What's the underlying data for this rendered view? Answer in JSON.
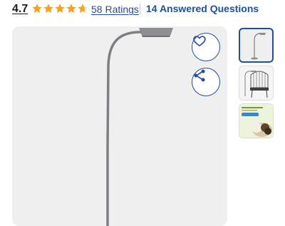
{
  "rating": {
    "value": "4.7",
    "stars_out_of_5": 4.7,
    "ratings_count_label": "58 Ratings",
    "questions_label": "14 Answered Questions"
  },
  "colors": {
    "star": "#f5a21e",
    "link": "#1f4ea3",
    "image_bg": "#efefef"
  },
  "product_image": {
    "icons": {
      "favorite": "heart-icon",
      "share": "share-icon"
    }
  },
  "thumbnails": [
    {
      "label": "floor-lamp-thumbnail",
      "selected": true
    },
    {
      "label": "birdcage-thumbnail",
      "selected": false
    },
    {
      "label": "review-promo-thumbnail",
      "selected": false
    }
  ]
}
